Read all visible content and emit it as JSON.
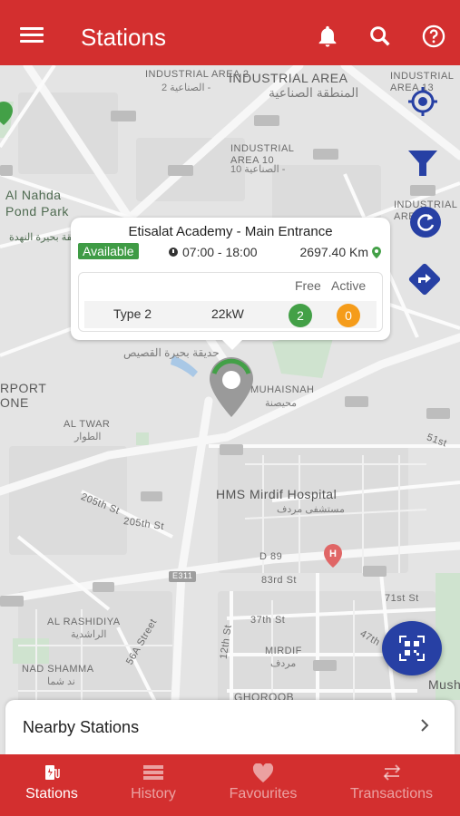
{
  "header": {
    "title": "Stations",
    "icons": [
      "menu-icon",
      "bell-icon",
      "search-icon",
      "help-icon"
    ]
  },
  "map": {
    "labels": {
      "industrial_area": "INDUSTRIAL AREA",
      "industrial_area_ar": "المنطقة الصناعية",
      "industrial_area_2": "INDUSTRIAL AREA 2",
      "industrial_area_2_ar": "الصناعية 2 -",
      "industrial_area_10": "INDUSTRIAL AREA 10",
      "industrial_area_10_ar": "الصناعية 10 -",
      "industrial_area_13": "INDUSTRIAL AREA 13",
      "industrial_area_right": "INDUSTRIAL AREA",
      "al_nahda_pond_park": "Al Nahda Pond Park",
      "al_nahda_ar": "حديقة بحيرة النهدة",
      "hafiza_lake_park_ar": "حديقة بحيرة القصيص",
      "muhaisnah": "MUHAISNAH",
      "muhaisnah_ar": "محيصنة",
      "airport_zone": "RPORT ONE",
      "al_twar": "AL TWAR",
      "al_twar_ar": "الطوار",
      "hms_hospital": "HMS Mirdif Hospital",
      "hms_hospital_ar": "مستشفى مردف",
      "d89": "D 89",
      "street_205_1": "205th St",
      "street_205_2": "205th St",
      "street_83": "83rd St",
      "street_37": "37th St",
      "street_71": "71st St",
      "street_47": "47th",
      "street_51": "51st",
      "street_12": "12th St",
      "street_56a": "56A Street",
      "al_rashidiya": "AL RASHIDIYA",
      "al_rashidiya_ar": "الراشدية",
      "nad_shamma": "NAD SHAMMA",
      "nad_shamma_ar": "ند شما",
      "mirdif": "MIRDIF",
      "mirdif_ar": "مردف",
      "ghoroob": "GHOROOB",
      "e311": "E311",
      "mush": "Mush"
    }
  },
  "popup": {
    "title": "Etisalat Academy - Main Entrance",
    "status": "Available",
    "hours": "07:00 - 18:00",
    "distance": "2697.40 Km",
    "headers": {
      "free": "Free",
      "active": "Active"
    },
    "connector": {
      "type": "Type 2",
      "power": "22kW",
      "free": "2",
      "active": "0"
    },
    "status_color": "#3f9b45"
  },
  "nearby": {
    "label": "Nearby Stations"
  },
  "nav": {
    "items": [
      {
        "label": "Stations",
        "icon": "charging-station-icon",
        "active": true
      },
      {
        "label": "History",
        "icon": "list-icon",
        "active": false
      },
      {
        "label": "Favourites",
        "icon": "heart-icon",
        "active": false
      },
      {
        "label": "Transactions",
        "icon": "transfer-icon",
        "active": false
      }
    ]
  },
  "colors": {
    "brand": "#d32f2f",
    "fab": "#2740a4",
    "free": "#43a047",
    "active": "#f59c1a"
  }
}
